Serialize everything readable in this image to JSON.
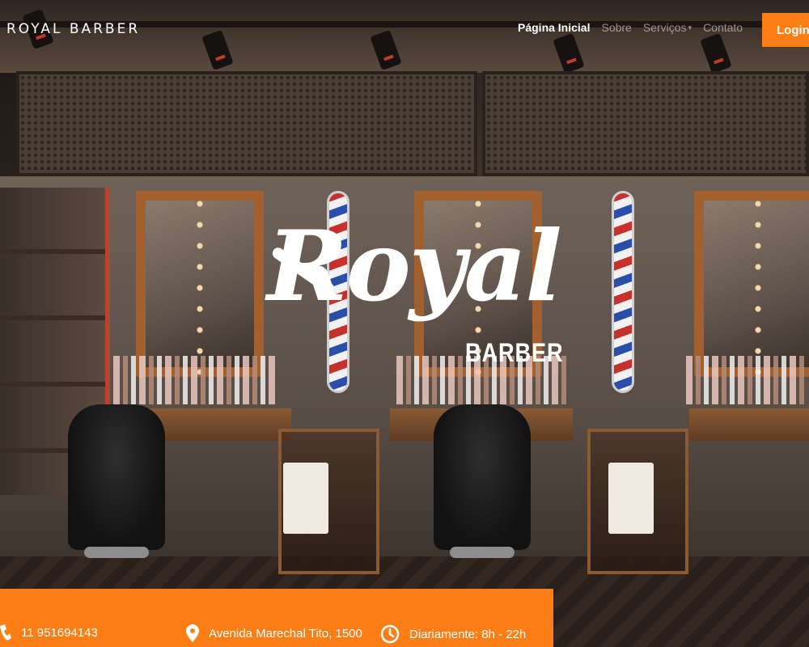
{
  "navbar": {
    "brand": "ROYAL BARBER",
    "links": [
      {
        "label": "Página Inicial",
        "active": true
      },
      {
        "label": "Sobre",
        "active": false
      },
      {
        "label": "Serviços",
        "active": false,
        "dropdown": true
      },
      {
        "label": "Contato",
        "active": false
      }
    ],
    "login_label": "Login"
  },
  "hero": {
    "logo_script": "Royal",
    "logo_sub": "BARBER"
  },
  "info_bar": {
    "phone": "11 951694143",
    "address": "Avenida Marechal Tito, 1500",
    "hours": "Diariamente: 8h - 22h"
  },
  "icons": {
    "caret": "chevron-down-icon",
    "phone": "phone-icon",
    "address": "map-pin-icon",
    "hours": "clock-icon"
  },
  "colors": {
    "accent": "#fd7e14",
    "text_light": "#ffffff"
  }
}
